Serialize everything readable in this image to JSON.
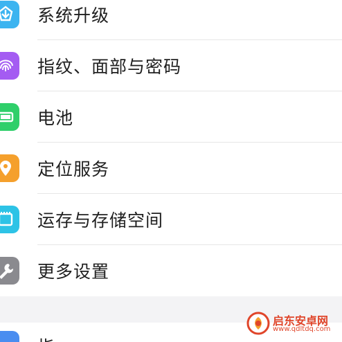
{
  "settings": {
    "items": [
      {
        "label": "系统升级",
        "icon": "system-update-icon",
        "color": "#3cb4f0"
      },
      {
        "label": "指纹、面部与密码",
        "icon": "fingerprint-icon",
        "color": "#a45cf2"
      },
      {
        "label": "电池",
        "icon": "battery-icon",
        "color": "#2fcf6a"
      },
      {
        "label": "定位服务",
        "icon": "location-icon",
        "color": "#f5a02c"
      },
      {
        "label": "运存与存储空间",
        "icon": "storage-icon",
        "color": "#2dc3e6"
      },
      {
        "label": "更多设置",
        "icon": "wrench-icon",
        "color": "#8a8a8f"
      }
    ],
    "partial_item": {
      "label": "指",
      "icon": "partial-icon",
      "color": "#4a8df0"
    }
  },
  "watermark": {
    "title": "启东安卓网",
    "url": "www.qdltdq.com",
    "color": "#e0452a"
  }
}
